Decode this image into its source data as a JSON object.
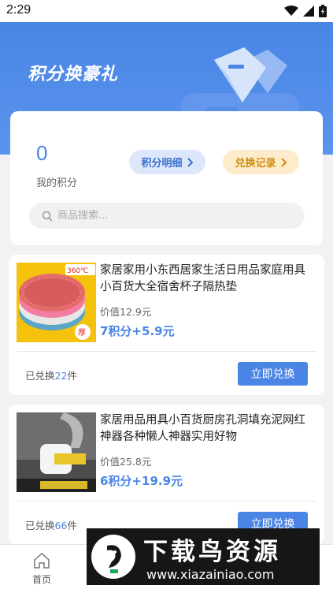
{
  "status_bar": {
    "time": "2:29"
  },
  "hero": {
    "title": "积分换豪礼"
  },
  "points": {
    "value": "0",
    "label": "我的积分",
    "detail_label": "积分明细",
    "record_label": "兑换记录"
  },
  "search": {
    "placeholder": "商品搜索..."
  },
  "products": [
    {
      "name": "家居家用小东西居家生活日用品家庭用具小百货大全宿舍杯子隔热垫",
      "price": "价值12.9元",
      "points_price": "7积分+5.9元",
      "redeemed_prefix": "已兑换",
      "redeemed_count": "22",
      "redeemed_suffix": "件",
      "button_label": "立即兑换",
      "thumb_tags": [
        "360℃",
        "厚"
      ]
    },
    {
      "name": "家居用品用具小百货厨房孔洞填充泥网红神器各种懒人神器实用好物",
      "price": "价值25.8元",
      "points_price": "6积分+19.9元",
      "redeemed_prefix": "已兑换",
      "redeemed_count": "66",
      "redeemed_suffix": "件",
      "button_label": "立即兑换"
    }
  ],
  "tabbar": {
    "home_label": "首页"
  },
  "watermark": {
    "title": "下载鸟资源",
    "url": "www.xiazainiao.com"
  },
  "colors": {
    "primary": "#4a85e6",
    "orange": "#d18b10",
    "background": "#f2f2f4"
  }
}
